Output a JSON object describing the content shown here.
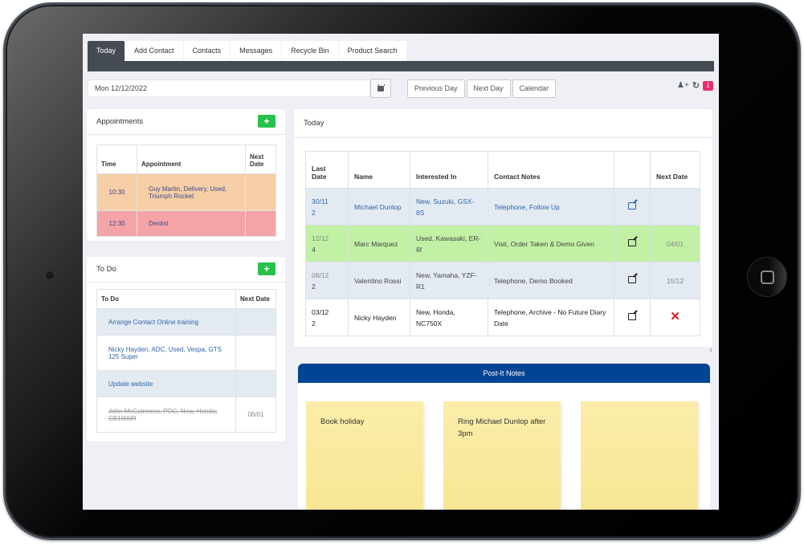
{
  "tabs": [
    {
      "label": "Today",
      "active": true
    },
    {
      "label": "Add Contact",
      "active": false
    },
    {
      "label": "Contacts",
      "active": false
    },
    {
      "label": "Messages",
      "active": false
    },
    {
      "label": "Recycle Bin",
      "active": false
    },
    {
      "label": "Product Search",
      "active": false
    }
  ],
  "date_bar": {
    "date_value": "Mon 12/12/2022",
    "calendar_icon": "calendar-icon",
    "previous_day": "Previous Day",
    "next_day": "Next Day",
    "calendar": "Calendar"
  },
  "top_icons": {
    "add_user_icon": "user-plus-icon",
    "refresh_icon": "refresh-icon",
    "notification_count": "1",
    "badge_color": "#ef2d6e"
  },
  "appointments": {
    "title": "Appointments",
    "add_label": "+",
    "columns": [
      "Time",
      "Appointment",
      "Next Date"
    ],
    "rows": [
      {
        "time": "10:30",
        "appointment": "Guy Martin, Delivery, Used, Triumph Rocket",
        "next_date": "",
        "color": "#f6cfa6"
      },
      {
        "time": "12:30",
        "appointment": "Dentist",
        "next_date": "",
        "color": "#f4a4a6"
      }
    ]
  },
  "todo": {
    "title": "To Do",
    "add_label": "+",
    "columns": [
      "To Do",
      "Next Date"
    ],
    "rows": [
      {
        "text": "Arrange Contact Online training",
        "next_date": "",
        "done": false
      },
      {
        "text": "Nicky Hayden, ADC, Used, Vespa, GTS 125 Super",
        "next_date": "",
        "done": false
      },
      {
        "text": "Update website",
        "next_date": "",
        "done": false
      },
      {
        "text": "John McGuinness, PDC, New, Honda, CB1000R",
        "next_date": "06/01",
        "done": true
      }
    ]
  },
  "today": {
    "title": "Today",
    "columns": [
      "Last Date",
      "Name",
      "Interested In",
      "Contact Notes",
      "",
      "Next Date"
    ],
    "rows": [
      {
        "last_date": "30/11",
        "count": "2",
        "name": "Michael Dunlop",
        "interested_in": "New, Suzuki, GSX-8S",
        "notes": "Telephone, Follow Up",
        "next_date": "",
        "status": "blue"
      },
      {
        "last_date": "12/12",
        "count": "4",
        "name": "Marc Marquez",
        "interested_in": "Used, Kawasaki, ER-6f",
        "notes": "Visit, Order Taken & Demo Given",
        "next_date": "04/01",
        "status": "green"
      },
      {
        "last_date": "08/12",
        "count": "2",
        "name": "Valentino Rossi",
        "interested_in": "New, Yamaha, YZF-R1",
        "notes": "Telephone, Demo Booked",
        "next_date": "15/12",
        "status": "grey"
      },
      {
        "last_date": "03/12",
        "count": "2",
        "name": "Nicky Hayden",
        "interested_in": "New, Honda, NC750X",
        "notes": "Telephone, Archive - No Future Diary Date",
        "next_date": "✕",
        "status": "white"
      }
    ]
  },
  "postit": {
    "title": "Post-It Notes",
    "header_color": "#004494",
    "notes": [
      {
        "text": "Book holiday"
      },
      {
        "text": "Ring Michael Dunlop after 3pm"
      },
      {
        "text": ""
      }
    ]
  }
}
